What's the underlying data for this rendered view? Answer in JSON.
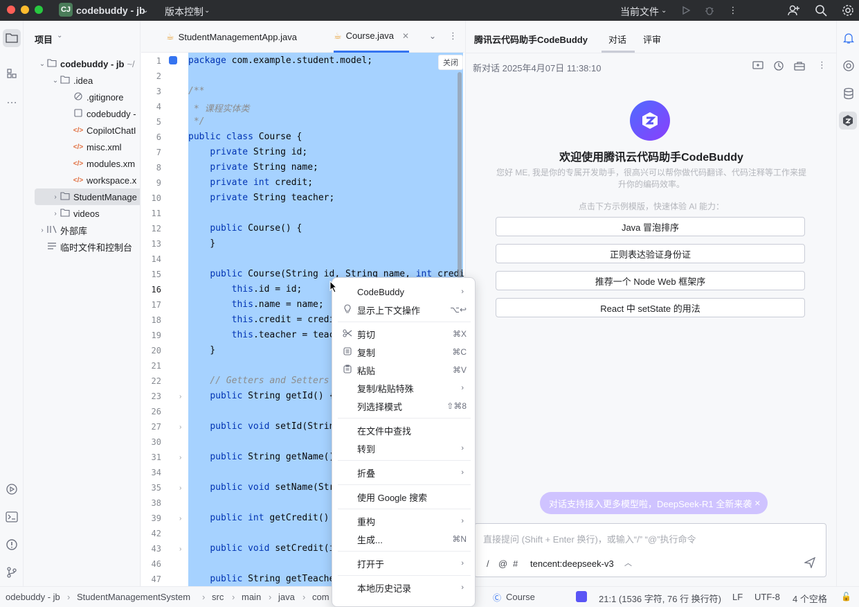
{
  "titlebar": {
    "project_badge": "CJ",
    "project_name": "codebuddy - jb",
    "vcs": "版本控制",
    "run_config": "当前文件"
  },
  "colors": {
    "selection": "#a6d2ff",
    "accent": "#3574f0",
    "titlebar": "#2b2d30"
  },
  "project": {
    "header": "项目",
    "items": [
      {
        "label": "codebuddy - jb",
        "suffix": "~/",
        "indent": 0,
        "icon": "folder-icon",
        "chev": "⌄",
        "bold": true
      },
      {
        "label": ".idea",
        "indent": 1,
        "icon": "folder-icon",
        "chev": "⌄"
      },
      {
        "label": ".gitignore",
        "indent": 2,
        "icon": "ignore-icon"
      },
      {
        "label": "codebuddy -",
        "indent": 2,
        "icon": "file-icon"
      },
      {
        "label": "CopilotChatI",
        "indent": 2,
        "icon": "xml-icon"
      },
      {
        "label": "misc.xml",
        "indent": 2,
        "icon": "xml-icon"
      },
      {
        "label": "modules.xm",
        "indent": 2,
        "icon": "xml-icon"
      },
      {
        "label": "workspace.x",
        "indent": 2,
        "icon": "xml-icon"
      },
      {
        "label": "StudentManage",
        "indent": 1,
        "icon": "folder-icon",
        "chev": "›",
        "selected": true
      },
      {
        "label": "videos",
        "indent": 1,
        "icon": "folder-icon",
        "chev": "›"
      },
      {
        "label": "外部库",
        "indent": 0,
        "icon": "library-icon",
        "chev": "›"
      },
      {
        "label": "临时文件和控制台",
        "indent": 0,
        "icon": "scratch-icon"
      }
    ]
  },
  "tabs": [
    {
      "label": "StudentManagementApp.java",
      "active": false
    },
    {
      "label": "Course.java",
      "active": true
    }
  ],
  "editor": {
    "close_label": "关闭",
    "lines": [
      {
        "n": "1",
        "t": "package com.example.student.model;"
      },
      {
        "n": "2",
        "t": ""
      },
      {
        "n": "3",
        "t": "/**"
      },
      {
        "n": "4",
        "t": " * 课程实体类"
      },
      {
        "n": "5",
        "t": " */"
      },
      {
        "n": "6",
        "t": "public class Course {"
      },
      {
        "n": "7",
        "t": "    private String id;"
      },
      {
        "n": "8",
        "t": "    private String name;"
      },
      {
        "n": "9",
        "t": "    private int credit;"
      },
      {
        "n": "10",
        "t": "    private String teacher;"
      },
      {
        "n": "11",
        "t": ""
      },
      {
        "n": "12",
        "t": "    public Course() {"
      },
      {
        "n": "13",
        "t": "    }"
      },
      {
        "n": "14",
        "t": ""
      },
      {
        "n": "15",
        "t": "    public Course(String id, String name, int credi"
      },
      {
        "n": "16",
        "t": "        this.id = id;"
      },
      {
        "n": "17",
        "t": "        this.name = name;"
      },
      {
        "n": "18",
        "t": "        this.credit = credi"
      },
      {
        "n": "19",
        "t": "        this.teacher = teac"
      },
      {
        "n": "20",
        "t": "    }"
      },
      {
        "n": "21",
        "t": ""
      },
      {
        "n": "22",
        "t": "    // Getters and Setters"
      },
      {
        "n": "23",
        "t": "    public String getId() {"
      },
      {
        "n": "26",
        "t": ""
      },
      {
        "n": "27",
        "t": "    public void setId(Strin"
      },
      {
        "n": "30",
        "t": ""
      },
      {
        "n": "31",
        "t": "    public String getName()"
      },
      {
        "n": "34",
        "t": ""
      },
      {
        "n": "35",
        "t": "    public void setName(Str"
      },
      {
        "n": "38",
        "t": ""
      },
      {
        "n": "39",
        "t": "    public int getCredit()"
      },
      {
        "n": "42",
        "t": ""
      },
      {
        "n": "43",
        "t": "    public void setCredit(i"
      },
      {
        "n": "46",
        "t": ""
      },
      {
        "n": "47",
        "t": "    public String getTeache"
      }
    ]
  },
  "context_menu": {
    "items": [
      {
        "type": "item",
        "label": "CodeBuddy",
        "arrow": "›"
      },
      {
        "type": "item",
        "label": "显示上下文操作",
        "shortcut": "⌥↩",
        "icon": "bulb-icon"
      },
      {
        "type": "sep"
      },
      {
        "type": "item",
        "label": "剪切",
        "shortcut": "⌘X",
        "icon": "scissors-icon"
      },
      {
        "type": "item",
        "label": "复制",
        "shortcut": "⌘C",
        "icon": "copy-icon"
      },
      {
        "type": "item",
        "label": "粘贴",
        "shortcut": "⌘V",
        "icon": "paste-icon"
      },
      {
        "type": "item",
        "label": "复制/粘贴特殊",
        "arrow": "›"
      },
      {
        "type": "item",
        "label": "列选择模式",
        "shortcut": "⇧⌘8"
      },
      {
        "type": "sep"
      },
      {
        "type": "item",
        "label": "在文件中查找"
      },
      {
        "type": "item",
        "label": "转到",
        "arrow": "›"
      },
      {
        "type": "sep"
      },
      {
        "type": "item",
        "label": "折叠",
        "arrow": "›"
      },
      {
        "type": "sep"
      },
      {
        "type": "item",
        "label": "使用 Google 搜索"
      },
      {
        "type": "sep"
      },
      {
        "type": "item",
        "label": "重构",
        "arrow": "›"
      },
      {
        "type": "item",
        "label": "生成...",
        "shortcut": "⌘N"
      },
      {
        "type": "sep"
      },
      {
        "type": "item",
        "label": "打开于",
        "arrow": "›"
      },
      {
        "type": "sep"
      },
      {
        "type": "item",
        "label": "本地历史记录",
        "arrow": "›"
      }
    ]
  },
  "assistant": {
    "title": "腾讯云代码助手CodeBuddy",
    "tabs": [
      "对话",
      "评审"
    ],
    "session": "新对话 2025年4月07日 11:38:10",
    "welcome": "欢迎使用腾讯云代码助手CodeBuddy",
    "intro": "您好 ME, 我是你的专属开发助手，很高兴可以帮你做代码翻译、代码注释等工作来提升你的编码效率。",
    "hint": "点击下方示例模版，快速体验 AI 能力：",
    "suggestions": [
      "Java 冒泡排序",
      "正则表达验证身份证",
      "推荐一个 Node Web 框架序",
      "React 中 setState 的用法"
    ],
    "banner": "对话支持接入更多模型啦，DeepSeek-R1 全新来袭",
    "input_placeholder": "直接提问 (Shift + Enter 换行)，或输入“/” “@”执行命令",
    "input_tools": [
      "/",
      "@",
      "#"
    ],
    "model": "tencent:deepseek-v3"
  },
  "status": {
    "breadcrumb": [
      "odebuddy - jb",
      "StudentManagementSystem",
      "src",
      "main",
      "java",
      "com"
    ],
    "class_name": "Course",
    "position": "21:1 (1536 字符, 76 行 换行符)",
    "line_sep": "LF",
    "encoding": "UTF-8",
    "indent": "4 个空格"
  }
}
